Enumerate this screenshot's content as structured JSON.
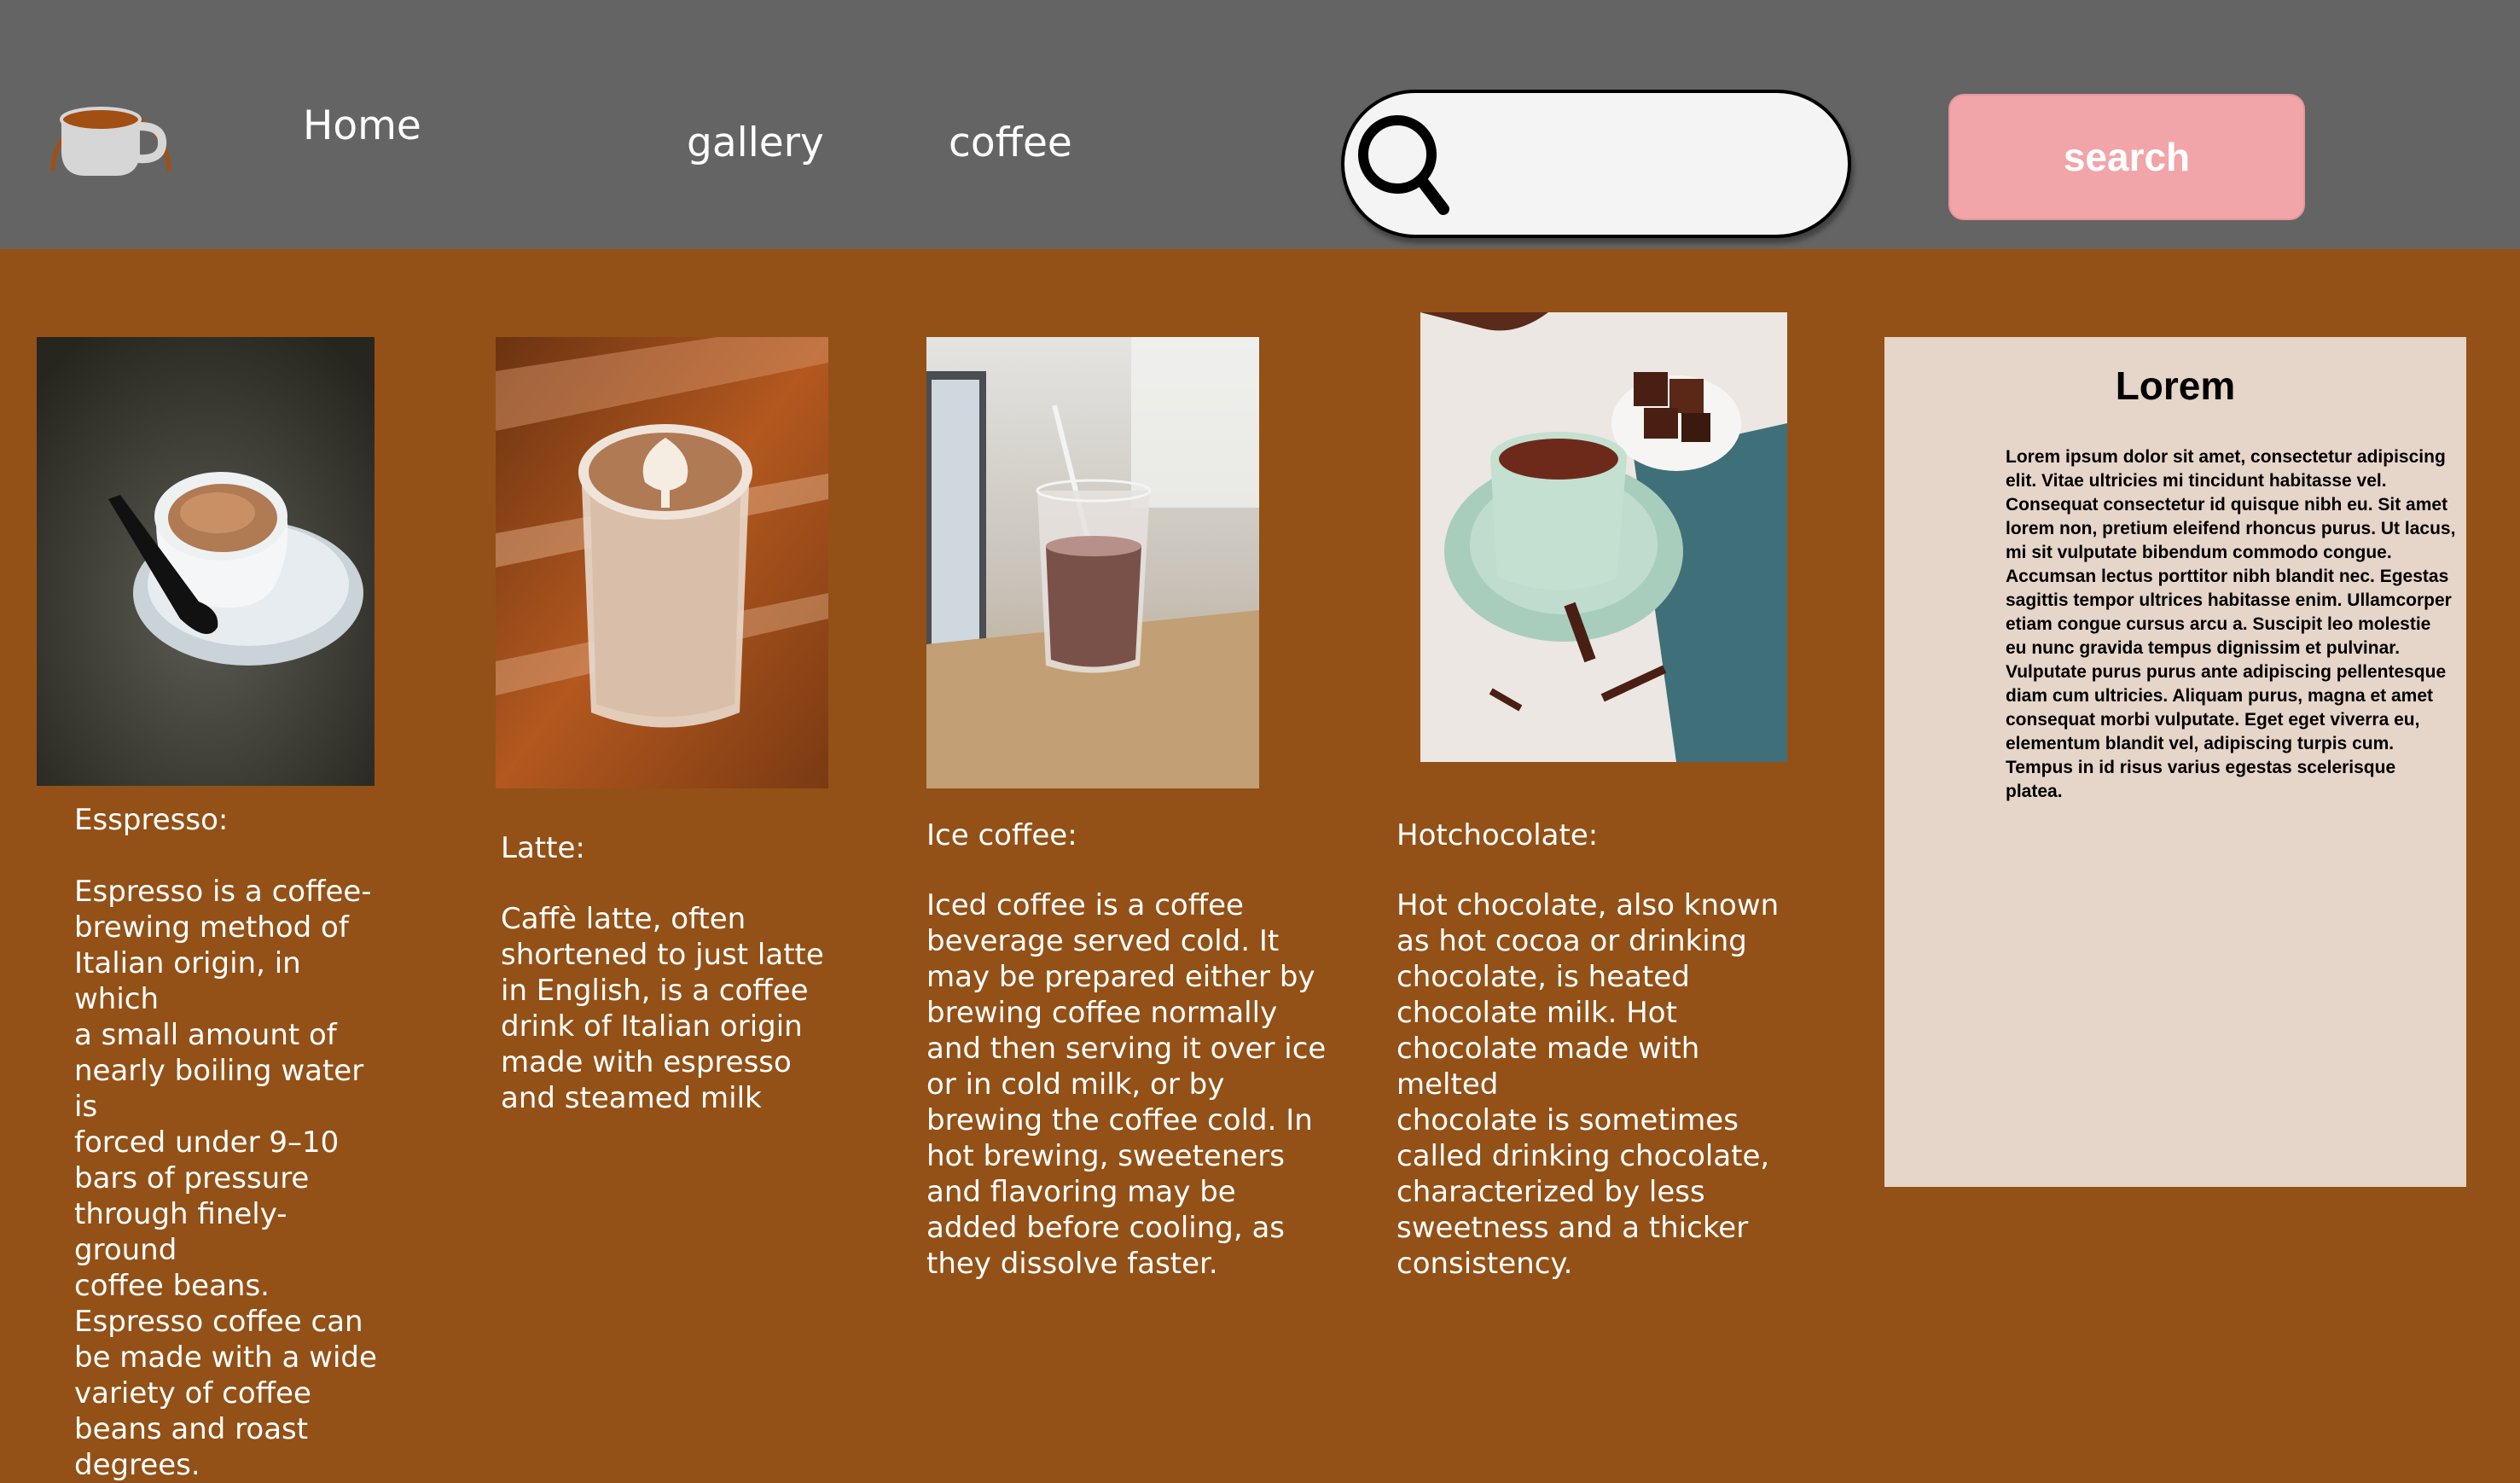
{
  "header": {
    "logo_icon": "coffee-cup-logo-icon",
    "nav": {
      "home": "Home",
      "gallery": "gallery",
      "coffee": "coffee"
    },
    "search": {
      "icon": "magnifier-icon",
      "input_value": "",
      "button_label": "search"
    }
  },
  "cards": [
    {
      "image": "espresso-cup-photo",
      "title": "Esspresso:",
      "description": "Espresso is a coffee-\nbrewing method of\nItalian origin, in which\na small amount of\nnearly boiling water is\nforced under 9–10\nbars of pressure\nthrough finely-ground\ncoffee beans.\nEspresso coffee can\nbe made with a wide\nvariety of coffee\nbeans and roast\ndegrees."
    },
    {
      "image": "latte-glass-photo",
      "title": "Latte:",
      "description": "Caffè latte, often\nshortened to just latte\nin English, is a coffee\ndrink of Italian origin\nmade with espresso\nand steamed milk"
    },
    {
      "image": "iced-coffee-glass-photo",
      "title": "Ice coffee:",
      "description": "Iced coffee is a coffee\nbeverage served cold. It\nmay be prepared either by\nbrewing coffee normally\nand then serving it over ice\nor in cold milk, or by\nbrewing the coffee cold. In\nhot brewing, sweeteners\nand flavoring may be\nadded before cooling, as\nthey dissolve faster."
    },
    {
      "image": "hot-chocolate-cup-photo",
      "title": "Hotchocolate:",
      "description": "Hot chocolate, also known\nas hot cocoa or drinking\nchocolate, is heated\nchocolate milk. Hot\nchocolate made with melted\nchocolate is sometimes\ncalled drinking chocolate,\ncharacterized by less\nsweetness and a thicker\nconsistency."
    }
  ],
  "sidebar": {
    "title": "Lorem",
    "body": "Lorem ipsum dolor sit amet, consectetur adipiscing elit. Vitae ultricies mi tincidunt habitasse vel. Consequat consectetur id quisque nibh eu. Sit amet lorem non, pretium eleifend rhoncus purus. Ut lacus, mi sit vulputate bibendum commodo congue. Accumsan lectus porttitor nibh blandit nec. Egestas sagittis tempor ultrices habitasse enim. Ullamcorper etiam congue cursus arcu a. Suscipit leo molestie eu nunc gravida tempus dignissim et pulvinar. Vulputate purus purus ante adipiscing pellentesque diam cum ultricies. Aliquam purus, magna et amet consequat morbi vulputate. Eget eget viverra eu, elementum blandit vel, adipiscing turpis cum. Tempus in id risus varius egestas scelerisque platea."
  },
  "colors": {
    "header_bg": "#646464",
    "page_bg": "#935117",
    "search_button_bg": "#f2a5a8",
    "panel_bg": "#e6d5c9"
  }
}
